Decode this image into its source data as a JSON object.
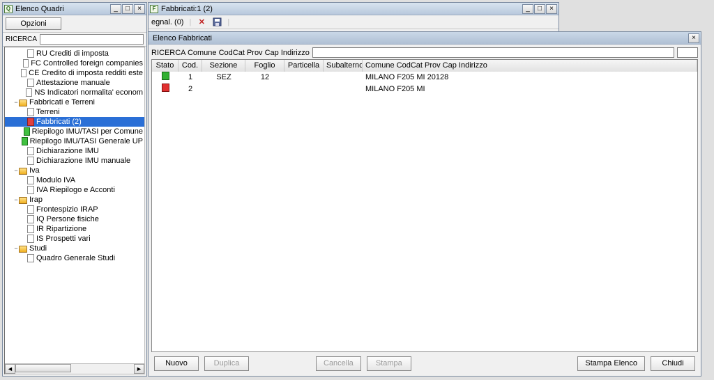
{
  "left_window": {
    "title": "Elenco Quadri",
    "options_label": "Opzioni",
    "search_label": "RICERCA",
    "search_value": "",
    "tree": [
      {
        "d": 2,
        "ico": "doc",
        "label": "RU Crediti di imposta"
      },
      {
        "d": 2,
        "ico": "doc",
        "label": "FC Controlled foreign companies"
      },
      {
        "d": 2,
        "ico": "doc",
        "label": "CE Credito di imposta redditi este"
      },
      {
        "d": 2,
        "ico": "doc",
        "label": "Attestazione manuale"
      },
      {
        "d": 2,
        "ico": "doc",
        "label": "NS Indicatori normalita' econom"
      },
      {
        "d": 1,
        "ico": "folder",
        "tw": "−",
        "label": "Fabbricati e Terreni"
      },
      {
        "d": 2,
        "ico": "doc",
        "label": "Terreni"
      },
      {
        "d": 2,
        "ico": "doc-red",
        "label": "Fabbricati (2)",
        "selected": true
      },
      {
        "d": 2,
        "ico": "doc-green",
        "label": "Riepilogo IMU/TASI per Comune"
      },
      {
        "d": 2,
        "ico": "doc-green",
        "label": "Riepilogo IMU/TASI Generale UP"
      },
      {
        "d": 2,
        "ico": "doc",
        "label": "Dichiarazione IMU"
      },
      {
        "d": 2,
        "ico": "doc",
        "label": "Dichiarazione IMU manuale"
      },
      {
        "d": 1,
        "ico": "folder",
        "tw": "−",
        "label": "Iva"
      },
      {
        "d": 2,
        "ico": "doc",
        "label": "Modulo IVA"
      },
      {
        "d": 2,
        "ico": "doc",
        "label": "IVA Riepilogo e Acconti"
      },
      {
        "d": 1,
        "ico": "folder",
        "tw": "−",
        "label": "Irap"
      },
      {
        "d": 2,
        "ico": "doc",
        "label": "Frontespizio IRAP"
      },
      {
        "d": 2,
        "ico": "doc",
        "label": "IQ Persone fisiche"
      },
      {
        "d": 2,
        "ico": "doc",
        "label": "IR Ripartizione"
      },
      {
        "d": 2,
        "ico": "doc",
        "label": "IS Prospetti vari"
      },
      {
        "d": 1,
        "ico": "folder",
        "tw": "−",
        "label": "Studi"
      },
      {
        "d": 2,
        "ico": "doc",
        "label": "Quadro Generale Studi"
      }
    ]
  },
  "back_window": {
    "title": "Fabbricati:1 (2)",
    "toolbar_tab": "egnal. (0)"
  },
  "dialog": {
    "title": "Elenco Fabbricati",
    "search_label": "RICERCA Comune CodCat Prov Cap Indirizzo",
    "search_value": "",
    "columns": {
      "stato": "Stato",
      "cod": "Cod.",
      "sez": "Sezione",
      "fog": "Foglio",
      "par": "Particella",
      "sub": "Subalterno",
      "com": "Comune CodCat Prov Cap Indirizzo"
    },
    "rows": [
      {
        "stato": "green",
        "cod": "1",
        "sez": "SEZ",
        "fog": "12",
        "par": "",
        "sub": "",
        "com": "MILANO F205 MI 20128"
      },
      {
        "stato": "red",
        "cod": "2",
        "sez": "",
        "fog": "",
        "par": "",
        "sub": "",
        "com": "MILANO F205 MI"
      }
    ],
    "buttons": {
      "nuovo": "Nuovo",
      "duplica": "Duplica",
      "cancella": "Cancella",
      "stampa": "Stampa",
      "stampa_elenco": "Stampa Elenco",
      "chiudi": "Chiudi"
    }
  }
}
